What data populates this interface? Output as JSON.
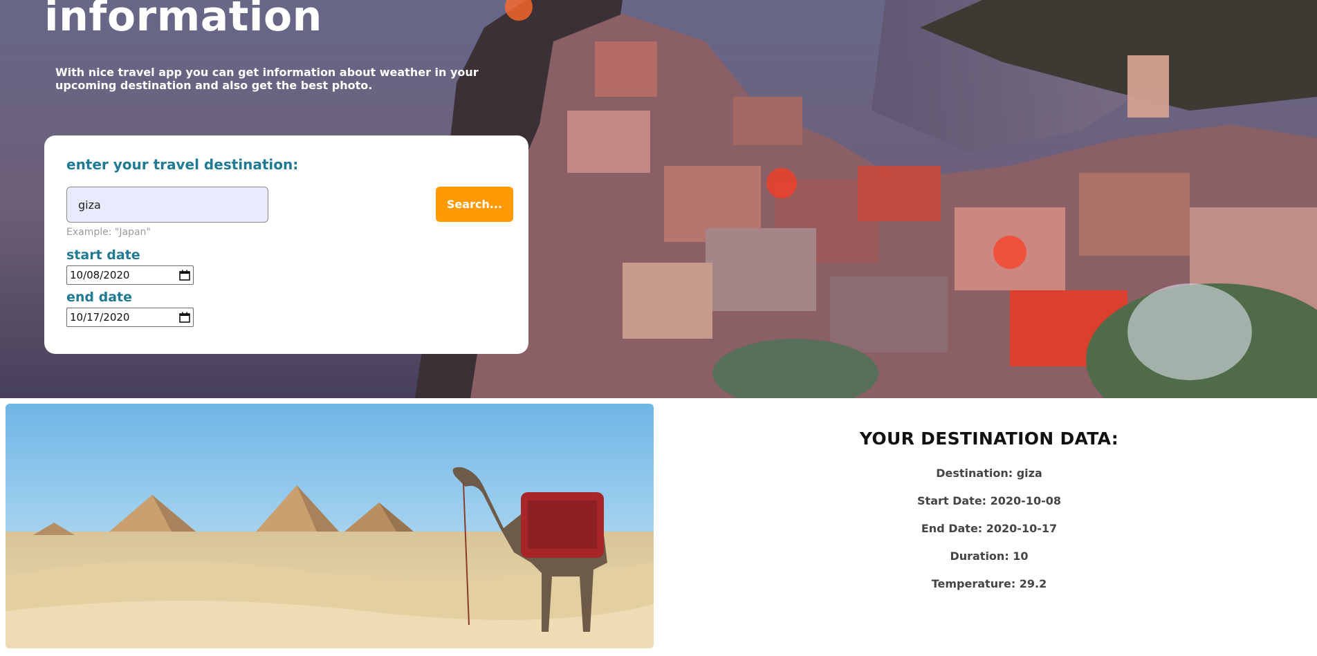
{
  "hero": {
    "title": "information",
    "description": "With nice travel app you can get information about weather in your upcoming destination and also get the best photo."
  },
  "form": {
    "destination_label": "enter your travel destination:",
    "destination_value": "giza",
    "search_label": "Search...",
    "example_text": "Example: \"Japan\"",
    "start_label": "start date",
    "start_value": "10/08/2020",
    "end_label": "end date",
    "end_value": "10/17/2020"
  },
  "results": {
    "title": "YOUR DESTINATION DATA:",
    "destination": "Destination: giza",
    "start_date": "Start Date: 2020-10-08",
    "end_date": "End Date: 2020-10-17",
    "duration": "Duration: 10",
    "temperature": "Temperature: 29.2"
  },
  "colors": {
    "accent_teal": "#217a94",
    "button_orange": "#ff9a05",
    "underline_blue": "#3ab0e5"
  },
  "icons": {
    "calendar": "calendar-icon"
  }
}
